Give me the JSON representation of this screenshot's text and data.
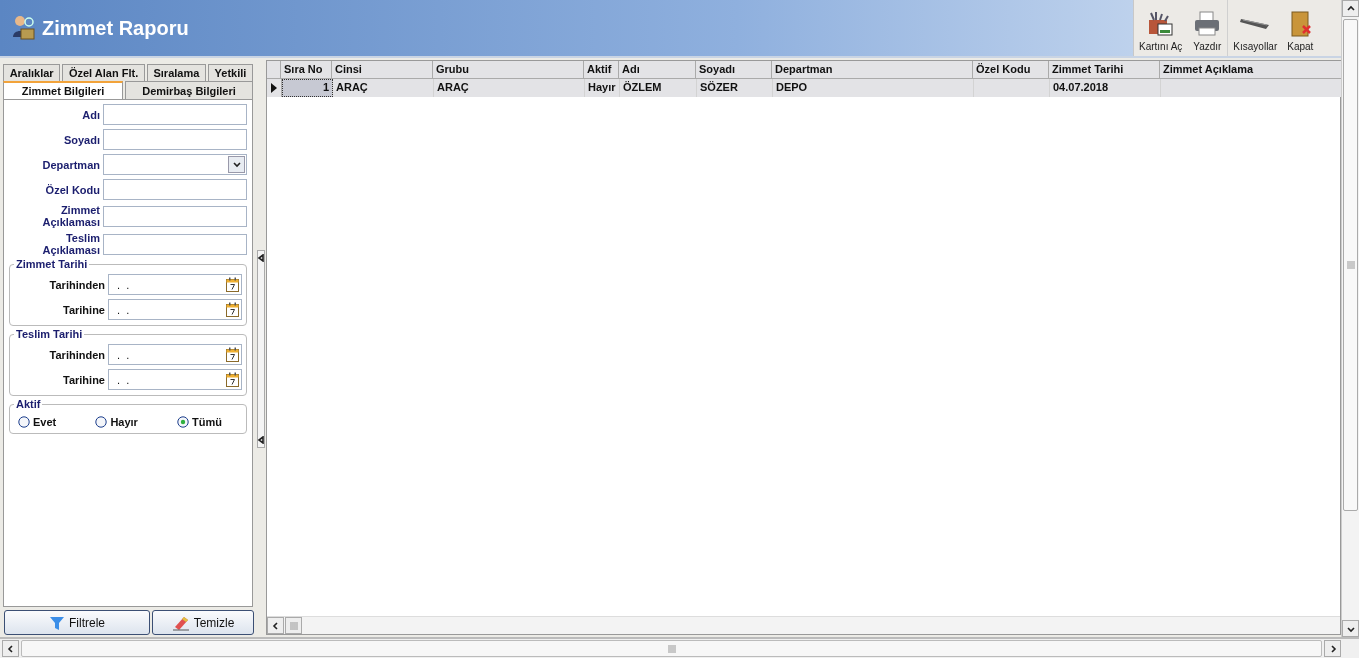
{
  "header": {
    "title": "Zimmet Raporu"
  },
  "toolbar": [
    {
      "label": "Kartını Aç",
      "kind": "card"
    },
    {
      "label": "Yazdır",
      "kind": "print"
    },
    {
      "label": "Kısayollar",
      "kind": "keyboard"
    },
    {
      "label": "Kapat",
      "kind": "close"
    }
  ],
  "filter_tabs": [
    [
      {
        "label": "Aralıklar",
        "selected": false
      },
      {
        "label": "Özel Alan Flt.",
        "selected": false
      },
      {
        "label": "Sıralama",
        "selected": false
      },
      {
        "label": "Yetkili",
        "selected": false
      }
    ],
    [
      {
        "label": "Zimmet Bilgileri",
        "selected": true
      },
      {
        "label": "Demirbaş Bilgileri",
        "selected": false
      }
    ]
  ],
  "fields": [
    {
      "label": "Adı",
      "kind": "text"
    },
    {
      "label": "Soyadı",
      "kind": "text"
    },
    {
      "label": "Departman",
      "kind": "dropdown"
    },
    {
      "label": "Özel Kodu",
      "kind": "text"
    },
    {
      "label": "Zimmet Açıklaması",
      "kind": "text"
    },
    {
      "label": "Teslim Açıklaması",
      "kind": "text"
    }
  ],
  "date_groups": [
    {
      "title": "Zimmet Tarihi",
      "fields": [
        {
          "label": "Tarihinden",
          "value": ".  ."
        },
        {
          "label": "Tarihine",
          "value": ".  ."
        }
      ]
    },
    {
      "title": "Teslim Tarihi",
      "fields": [
        {
          "label": "Tarihinden",
          "value": ".  ."
        },
        {
          "label": "Tarihine",
          "value": ".  ."
        }
      ]
    }
  ],
  "aktif": {
    "title": "Aktif",
    "options": [
      {
        "label": "Evet",
        "selected": false
      },
      {
        "label": "Hayır",
        "selected": false
      },
      {
        "label": "Tümü",
        "selected": true
      }
    ]
  },
  "buttons": [
    {
      "label": "Filtrele",
      "kind": "filter"
    },
    {
      "label": "Temizle",
      "kind": "clear"
    }
  ],
  "table": {
    "columns": [
      "Sıra No",
      "Cinsi",
      "Grubu",
      "Aktif",
      "Adı",
      "Soyadı",
      "Departman",
      "Özel Kodu",
      "Zimmet Tarihi",
      "Zimmet Açıklama"
    ],
    "rows": [
      {
        "current": true,
        "cells": [
          "1",
          "ARAÇ",
          "ARAÇ",
          "Hayır",
          "ÖZLEM",
          "SÖZER",
          "DEPO",
          "",
          "04.07.2018",
          ""
        ]
      }
    ]
  }
}
